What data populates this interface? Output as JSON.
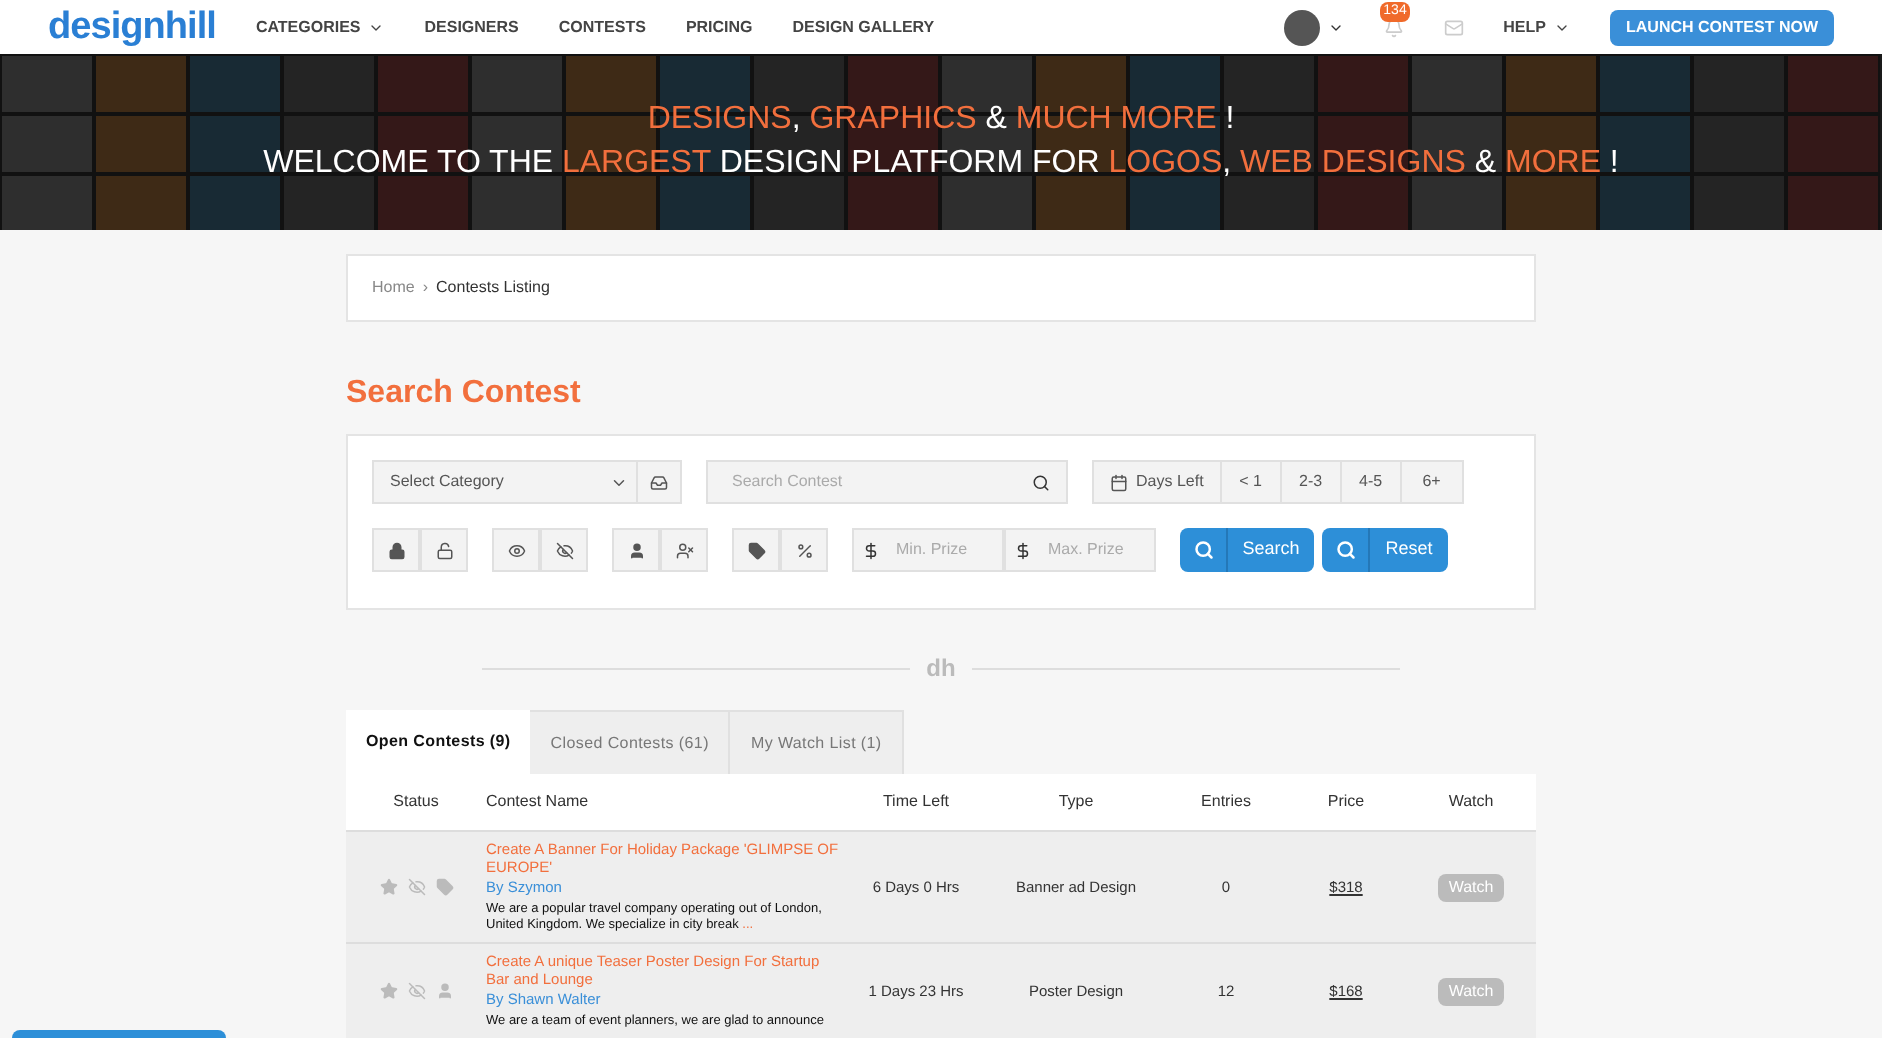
{
  "nav": {
    "logo": "designhill",
    "items": [
      {
        "label": "CATEGORIES",
        "dropdown": true
      },
      {
        "label": "DESIGNERS",
        "dropdown": false
      },
      {
        "label": "CONTESTS",
        "dropdown": false
      },
      {
        "label": "PRICING",
        "dropdown": false
      },
      {
        "label": "DESIGN GALLERY",
        "dropdown": false
      }
    ],
    "notifications": "134",
    "help": "HELP",
    "cta": "LAUNCH CONTEST NOW"
  },
  "hero": {
    "lines": [
      [
        {
          "text": "DESIGNS",
          "highlight": true
        },
        {
          "text": ", ",
          "highlight": false
        },
        {
          "text": "GRAPHICS",
          "highlight": true
        },
        {
          "text": " & ",
          "highlight": false
        },
        {
          "text": "MUCH MORE",
          "highlight": true
        },
        {
          "text": " !",
          "highlight": false
        }
      ],
      [
        {
          "text": "WELCOME TO THE ",
          "highlight": false
        },
        {
          "text": "LARGEST",
          "highlight": true
        },
        {
          "text": " DESIGN PLATFORM FOR ",
          "highlight": false
        },
        {
          "text": "LOGOS",
          "highlight": true
        },
        {
          "text": ", ",
          "highlight": false
        },
        {
          "text": "WEB DESIGNS",
          "highlight": true
        },
        {
          "text": " & ",
          "highlight": false
        },
        {
          "text": "MORE",
          "highlight": true
        },
        {
          "text": " !",
          "highlight": false
        }
      ]
    ]
  },
  "breadcrumb": {
    "separator": "›",
    "items": [
      "Home",
      "Contests Listing"
    ]
  },
  "search": {
    "title": "Search Contest",
    "category": {
      "placeholder": "Select Category"
    },
    "query": {
      "placeholder": "Search Contest"
    },
    "days_label": "Days Left",
    "days": [
      "< 1",
      "2-3",
      "4-5",
      "6+"
    ],
    "filter_groups": [
      [
        {
          "kind": "lock"
        },
        {
          "kind": "unlock"
        }
      ],
      [
        {
          "kind": "eye"
        },
        {
          "kind": "eye-off"
        }
      ],
      [
        {
          "kind": "user"
        },
        {
          "kind": "user-off"
        }
      ],
      [
        {
          "kind": "tag"
        },
        {
          "kind": "percent"
        }
      ]
    ],
    "min_prize": {
      "placeholder": "Min. Prize"
    },
    "max_prize": {
      "placeholder": "Max. Prize"
    },
    "buttons": [
      "Search",
      "Reset"
    ]
  },
  "divider_logo": "dh",
  "tabs": [
    {
      "label": "Open Contests (9)",
      "selected": true
    },
    {
      "label": "Closed Contests (61)",
      "selected": false
    },
    {
      "label": "My Watch List (1)",
      "selected": false
    }
  ],
  "table": {
    "columns": [
      "Status",
      "Contest Name",
      "Time Left",
      "Type",
      "Entries",
      "Price",
      "Watch"
    ],
    "rows": [
      {
        "status_icons": [
          {
            "kind": "star"
          },
          {
            "kind": "eye-off"
          },
          {
            "kind": "tag"
          }
        ],
        "name": "Create A Banner For Holiday Package 'GLIMPSE OF EUROPE'",
        "by": "By Szymon",
        "description": "We are a popular travel company operating out of London, United Kingdom. We specialize in city break",
        "more": "...",
        "time_left": "6 Days 0 Hrs",
        "type": "Banner ad Design",
        "entries": "0",
        "price": "$318",
        "watch": "Watch"
      },
      {
        "status_icons": [
          {
            "kind": "star"
          },
          {
            "kind": "eye-off"
          },
          {
            "kind": "user"
          }
        ],
        "name": "Create A unique Teaser Poster Design For Startup Bar and Lounge",
        "by": "By Shawn Walter",
        "description": "We are a team of event planners, we are glad to announce",
        "more": "",
        "time_left": "1 Days 23 Hrs",
        "type": "Poster Design",
        "entries": "12",
        "price": "$168",
        "watch": "Watch"
      }
    ]
  }
}
